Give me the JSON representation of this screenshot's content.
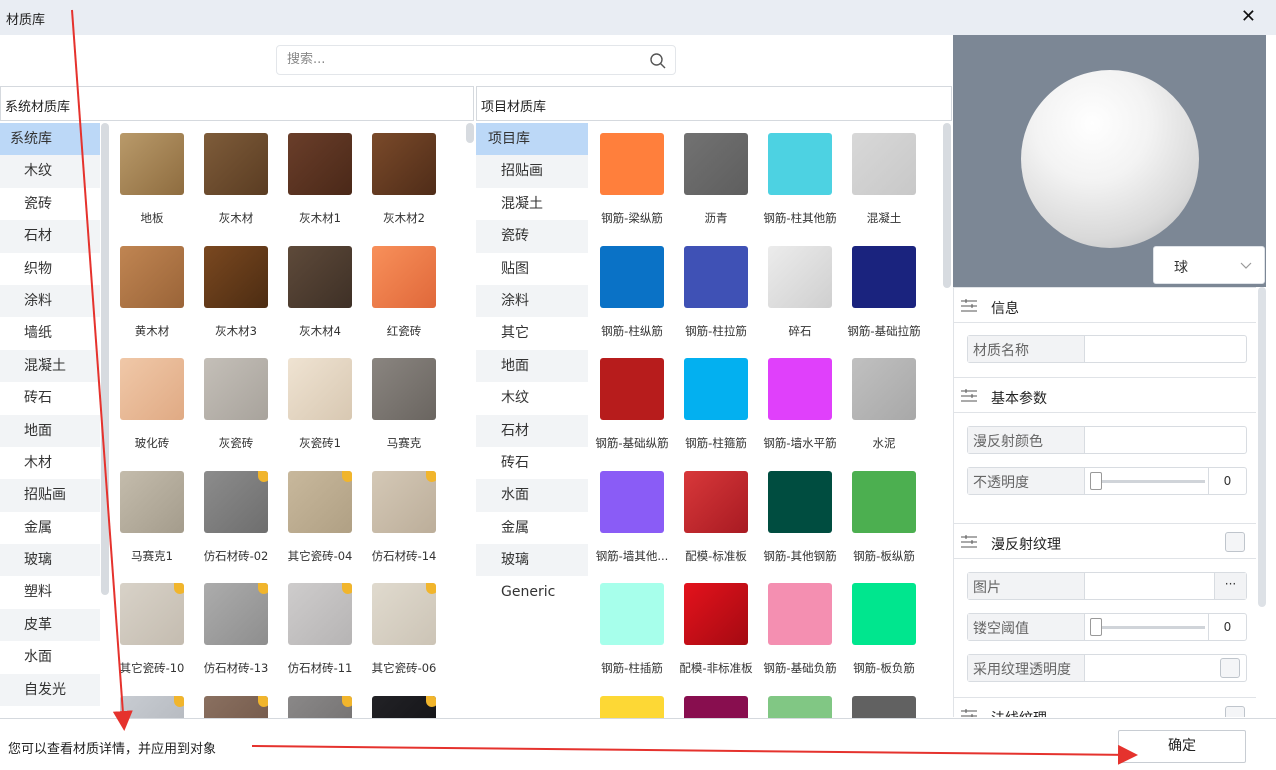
{
  "window": {
    "title": "材质库",
    "close_glyph": "✕"
  },
  "search": {
    "placeholder": "搜索..."
  },
  "system_panel": {
    "header": "系统材质库",
    "categories": [
      "系统库",
      "木纹",
      "瓷砖",
      "石材",
      "织物",
      "涂料",
      "墙纸",
      "混凝土",
      "砖石",
      "地面",
      "木材",
      "招贴画",
      "金属",
      "玻璃",
      "塑料",
      "皮革",
      "水面",
      "自发光"
    ],
    "selected": 0,
    "tiles": [
      {
        "label": "地板",
        "colors": [
          "#b99a6a",
          "#8e6c3f"
        ],
        "badge": false
      },
      {
        "label": "灰木材",
        "colors": [
          "#7e5c3a",
          "#5a3c22"
        ],
        "badge": false
      },
      {
        "label": "灰木材1",
        "colors": [
          "#6a3e2a",
          "#4a2818"
        ],
        "badge": false
      },
      {
        "label": "灰木材2",
        "colors": [
          "#7a4a2a",
          "#4f2c18"
        ],
        "badge": false
      },
      {
        "label": "黄木材",
        "colors": [
          "#c08552",
          "#9a6438"
        ],
        "badge": false
      },
      {
        "label": "灰木材3",
        "colors": [
          "#7a4820",
          "#4c2c12"
        ],
        "badge": false
      },
      {
        "label": "灰木材4",
        "colors": [
          "#5e4a3a",
          "#3e3026"
        ],
        "badge": false
      },
      {
        "label": "红瓷砖",
        "colors": [
          "#f8905a",
          "#e0683a"
        ],
        "badge": false
      },
      {
        "label": "玻化砖",
        "colors": [
          "#f0c8a8",
          "#e0aa84"
        ],
        "badge": false
      },
      {
        "label": "灰瓷砖",
        "colors": [
          "#c4bfb8",
          "#a8a39c"
        ],
        "badge": false
      },
      {
        "label": "灰瓷砖1",
        "colors": [
          "#efe3d2",
          "#d8c8b2"
        ],
        "badge": false
      },
      {
        "label": "马赛克",
        "colors": [
          "#8a8580",
          "#6a6560"
        ],
        "badge": false
      },
      {
        "label": "马赛克1",
        "colors": [
          "#c4bcac",
          "#a49c8c"
        ],
        "badge": false
      },
      {
        "label": "仿石材砖-02",
        "colors": [
          "#8c8c8c",
          "#6e6e6e"
        ],
        "badge": true
      },
      {
        "label": "其它瓷砖-04",
        "colors": [
          "#c8b89c",
          "#b0a084"
        ],
        "badge": true
      },
      {
        "label": "仿石材砖-14",
        "colors": [
          "#d4c8b6",
          "#bcae9a"
        ],
        "badge": true
      },
      {
        "label": "其它瓷砖-10",
        "colors": [
          "#d8d2c8",
          "#c4bcb0"
        ],
        "badge": true
      },
      {
        "label": "仿石材砖-13",
        "colors": [
          "#acacac",
          "#8e8e8e"
        ],
        "badge": true
      },
      {
        "label": "仿石材砖-11",
        "colors": [
          "#cecccc",
          "#b6b4b4"
        ],
        "badge": true
      },
      {
        "label": "其它瓷砖-06",
        "colors": [
          "#e0dace",
          "#ccc4b6"
        ],
        "badge": true
      },
      {
        "label": "",
        "colors": [
          "#c8ccd2",
          "#b0b4ba"
        ],
        "badge": true
      },
      {
        "label": "",
        "colors": [
          "#8a7060",
          "#6e5446"
        ],
        "badge": true
      },
      {
        "label": "",
        "colors": [
          "#8a8888",
          "#6e6c6c"
        ],
        "badge": true
      },
      {
        "label": "",
        "colors": [
          "#222226",
          "#101014"
        ],
        "badge": true
      }
    ]
  },
  "project_panel": {
    "header": "项目材质库",
    "root": "项目库",
    "categories": [
      "招贴画",
      "混凝土",
      "瓷砖",
      "贴图",
      "涂料",
      "其它",
      "地面",
      "木纹",
      "石材",
      "砖石",
      "水面",
      "金属",
      "玻璃",
      "Generic"
    ],
    "tiles": [
      {
        "label": "钢筋-梁纵筋",
        "colors": [
          "#ff7f3c",
          "#ff7f3c"
        ]
      },
      {
        "label": "沥青",
        "colors": [
          "#727272",
          "#5e5e5e"
        ]
      },
      {
        "label": "钢筋-柱其他筋",
        "colors": [
          "#4dd2e2",
          "#4dd2e2"
        ]
      },
      {
        "label": "混凝土",
        "colors": [
          "#d8d8d8",
          "#c8c8c8"
        ]
      },
      {
        "label": "钢筋-柱纵筋",
        "colors": [
          "#0a72c6",
          "#0a72c6"
        ]
      },
      {
        "label": "钢筋-柱拉筋",
        "colors": [
          "#3f51b5",
          "#3f51b5"
        ]
      },
      {
        "label": "碎石",
        "colors": [
          "#ececec",
          "#cfcfcf"
        ]
      },
      {
        "label": "钢筋-基础拉筋",
        "colors": [
          "#1a237e",
          "#1a237e"
        ]
      },
      {
        "label": "钢筋-基础纵筋",
        "colors": [
          "#b71c1c",
          "#b71c1c"
        ]
      },
      {
        "label": "钢筋-柱箍筋",
        "colors": [
          "#03b0f0",
          "#03b0f0"
        ]
      },
      {
        "label": "钢筋-墙水平筋",
        "colors": [
          "#e040fb",
          "#e040fb"
        ]
      },
      {
        "label": "水泥",
        "colors": [
          "#c0c0c0",
          "#a8a8a8"
        ]
      },
      {
        "label": "钢筋-墙其他...",
        "colors": [
          "#8a5cf6",
          "#8a5cf6"
        ]
      },
      {
        "label": "配模-标准板",
        "colors": [
          "#d8383a",
          "#a81a22"
        ]
      },
      {
        "label": "钢筋-其他钢筋",
        "colors": [
          "#004d40",
          "#004d40"
        ]
      },
      {
        "label": "钢筋-板纵筋",
        "colors": [
          "#4caf50",
          "#4caf50"
        ]
      },
      {
        "label": "钢筋-柱插筋",
        "colors": [
          "#a7ffeb",
          "#a7ffeb"
        ]
      },
      {
        "label": "配模-非标准板",
        "colors": [
          "#e4121c",
          "#a40a12"
        ]
      },
      {
        "label": "钢筋-基础负筋",
        "colors": [
          "#f48fb1",
          "#f48fb1"
        ]
      },
      {
        "label": "钢筋-板负筋",
        "colors": [
          "#00e68e",
          "#00e68e"
        ]
      },
      {
        "label": "",
        "colors": [
          "#fdd835",
          "#fdd835"
        ]
      },
      {
        "label": "",
        "colors": [
          "#880e4f",
          "#880e4f"
        ]
      },
      {
        "label": "",
        "colors": [
          "#81c784",
          "#81c784"
        ]
      },
      {
        "label": "",
        "colors": [
          "#616161",
          "#616161"
        ]
      }
    ]
  },
  "preview": {
    "shape": "球"
  },
  "properties": {
    "info": {
      "title": "信息",
      "name_label": "材质名称",
      "name_value": ""
    },
    "basic": {
      "title": "基本参数",
      "diffuse_label": "漫反射颜色",
      "opacity_label": "不透明度",
      "opacity_value": "0"
    },
    "diffuse_texture": {
      "title": "漫反射纹理",
      "image_label": "图片",
      "more": "···",
      "cutout_label": "镂空阈值",
      "cutout_value": "0",
      "use_alpha_label": "采用纹理透明度"
    },
    "normal": {
      "title": "法线纹理"
    }
  },
  "footer": {
    "message": "您可以查看材质详情，并应用到对象",
    "ok_label": "确定"
  },
  "colors": {
    "accent_selected": "#bcd8f7",
    "annotation_red": "#e5322d",
    "preview_bg": "#7c8795"
  }
}
